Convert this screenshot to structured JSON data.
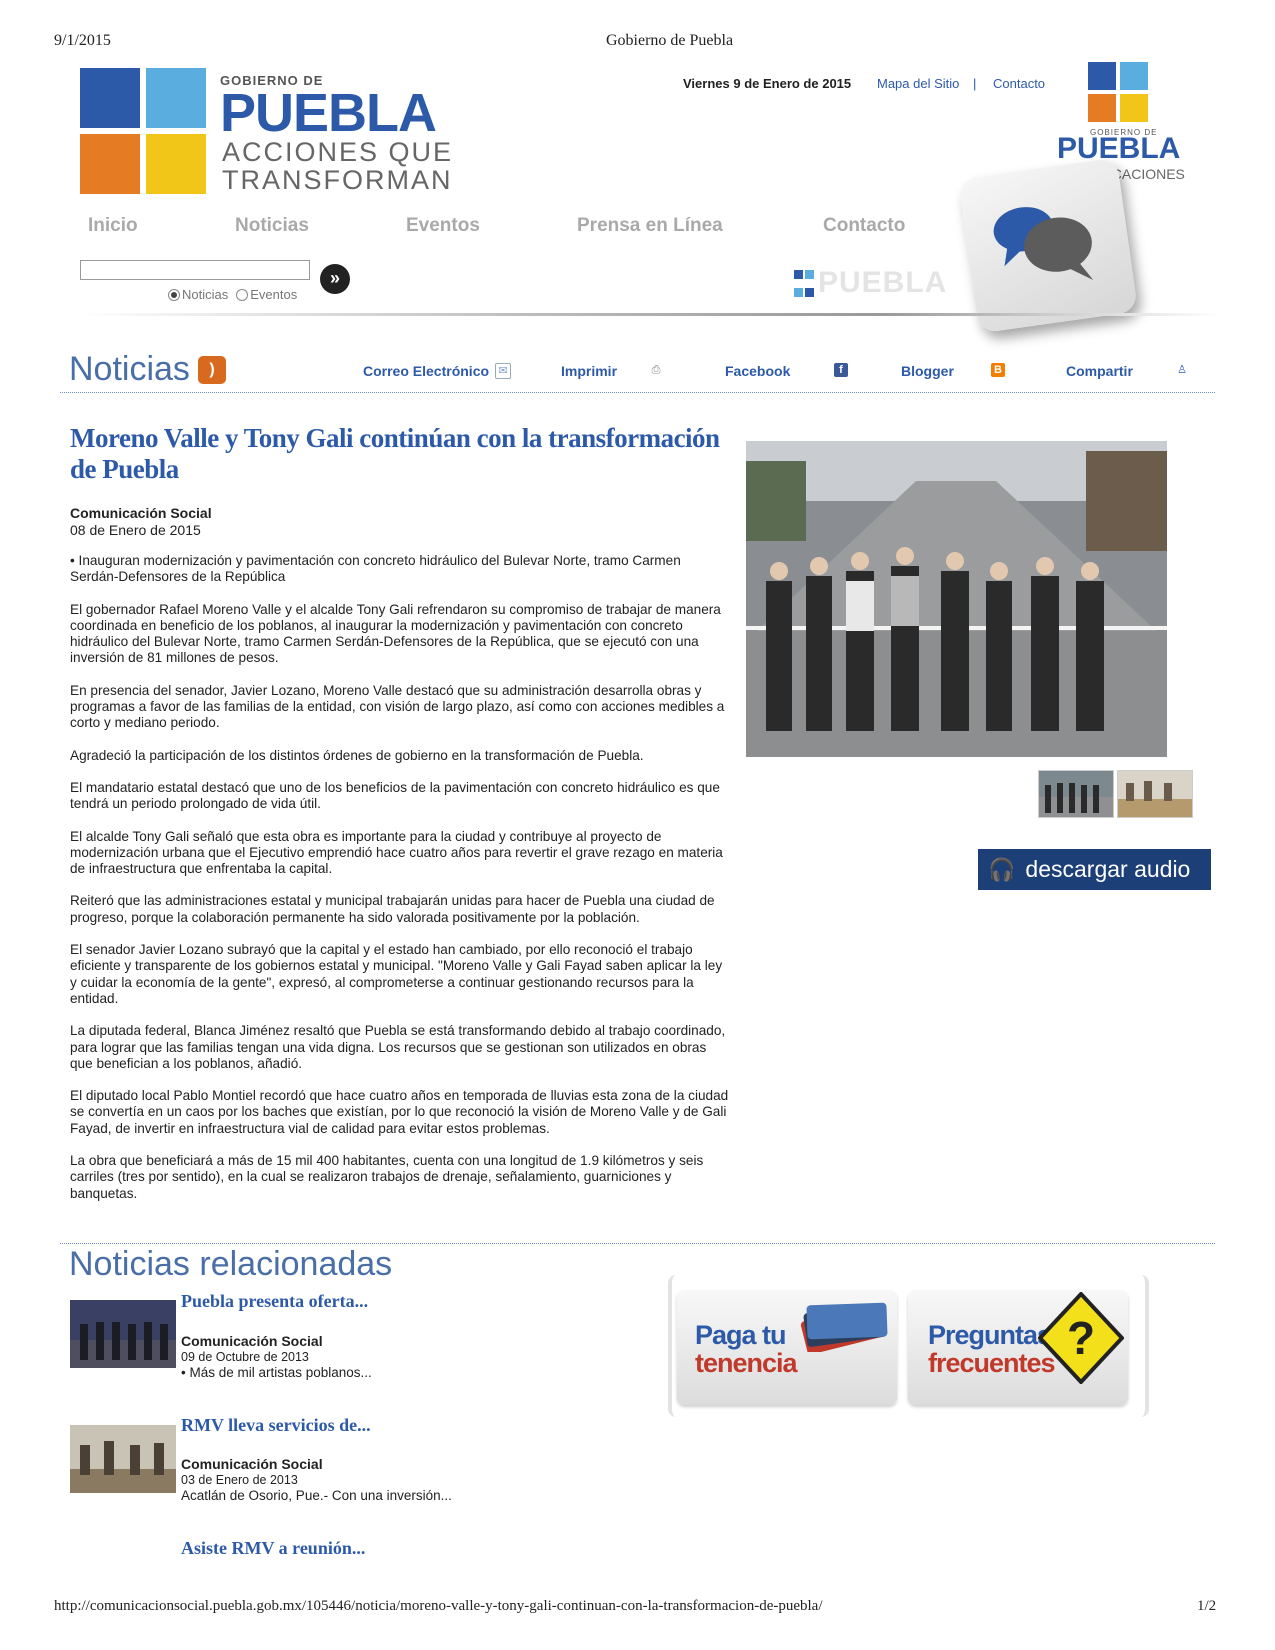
{
  "print": {
    "date": "9/1/2015",
    "title": "Gobierno de Puebla",
    "url": "http://comunicacionsocial.puebla.gob.mx/105446/noticia/moreno-valle-y-tony-gali-continuan-con-la-transformacion-de-puebla/",
    "page": "1/2"
  },
  "logo": {
    "gobierno": "GOBIERNO DE",
    "puebla": "PUEBLA",
    "line1": "ACCIONES QUE",
    "line2": "TRANSFORMAN"
  },
  "top": {
    "date": "Viernes 9 de Enero de 2015",
    "sitemap": "Mapa del Sitio",
    "separator": "|",
    "contact": "Contacto"
  },
  "com_logo": {
    "gobierno": "GOBIERNO DE",
    "puebla": "PUEBLA",
    "sub": "COMUNICACIONES"
  },
  "nav": [
    "Inicio",
    "Noticias",
    "Eventos",
    "Prensa en Línea",
    "Contacto"
  ],
  "search": {
    "value": "",
    "button": "»",
    "options": [
      "Noticias",
      "Eventos"
    ],
    "selected": "Noticias",
    "watermark": "PUEBLA"
  },
  "noticias_bar": {
    "title": "Noticias",
    "share": [
      "Correo Electrónico",
      "Imprimir",
      "Facebook",
      "Blogger",
      "Compartir"
    ]
  },
  "article": {
    "title": "Moreno Valle y Tony Gali continúan con la transformación de Puebla",
    "author": "Comunicación Social",
    "date": "08 de Enero de 2015",
    "paragraphs": [
      "• Inauguran modernización y pavimentación con concreto hidráulico del Bulevar Norte, tramo Carmen Serdán-Defensores de la República",
      "El gobernador Rafael Moreno Valle y el alcalde Tony Gali refrendaron su compromiso de trabajar de manera coordinada en beneficio de los poblanos, al inaugurar la modernización y pavimentación con concreto hidráulico del Bulevar Norte, tramo Carmen Serdán-Defensores de la República, que se ejecutó con una inversión de 81 millones de pesos.",
      "En presencia del senador, Javier Lozano, Moreno Valle destacó que su administración desarrolla obras y programas a favor de las familias de la entidad, con visión de largo plazo, así como con acciones medibles a corto y mediano periodo.",
      "Agradeció la participación de los distintos órdenes de gobierno en la transformación de Puebla.",
      "El mandatario estatal destacó que uno de los beneficios de la pavimentación con concreto hidráulico es que tendrá un periodo prolongado de vida útil.",
      "El alcalde Tony Gali señaló que esta obra es importante para la ciudad y contribuye al proyecto de modernización urbana que el Ejecutivo emprendió hace cuatro años para revertir el grave rezago en materia de infraestructura que enfrentaba la capital.",
      "Reiteró que las administraciones estatal y municipal trabajarán unidas para hacer de Puebla una ciudad de progreso, porque la colaboración permanente ha sido valorada positivamente por la población.",
      "El senador Javier Lozano subrayó que la capital y el estado han cambiado, por ello reconoció el trabajo eficiente y transparente de los gobiernos estatal y municipal. \"Moreno Valle y Gali Fayad saben aplicar la ley y cuidar la economía de la gente\", expresó, al comprometerse a continuar gestionando recursos para la entidad.",
      "La diputada federal, Blanca Jiménez resaltó que Puebla se está transformando debido al trabajo coordinado, para lograr que las familias tengan una vida digna. Los recursos que se gestionan son utilizados en obras que benefician a los poblanos, añadió.",
      "El diputado local Pablo Montiel recordó que hace cuatro años en temporada de lluvias esta zona de la ciudad se convertía en un caos por los baches que existían, por lo que reconoció la visión de Moreno Valle y de Gali Fayad, de invertir en infraestructura vial de calidad para evitar estos problemas.",
      "La obra que beneficiará a más de 15 mil 400 habitantes, cuenta con una longitud de 1.9 kilómetros y seis carriles (tres por sentido), en la cual se realizaron trabajos de drenaje, señalamiento, guarniciones y banquetas."
    ]
  },
  "audio": {
    "label": "descargar audio"
  },
  "related": {
    "title": "Noticias relacionadas",
    "items": [
      {
        "headline": "Puebla presenta oferta...",
        "author": "Comunicación Social",
        "date": "09 de Octubre de 2013",
        "desc": "• Más de mil artistas poblanos..."
      },
      {
        "headline": "RMV lleva servicios de...",
        "author": "Comunicación Social",
        "date": "03 de Enero de 2013",
        "desc": "Acatlán de Osorio, Pue.- Con una inversión..."
      },
      {
        "headline": "Asiste RMV a reunión..."
      }
    ]
  },
  "banners": [
    {
      "line1": "Paga tu",
      "line2": "tenencia"
    },
    {
      "line1": "Preguntas",
      "line2": "frecuentes"
    }
  ],
  "colors": {
    "link_blue": "#2d5aa8",
    "title_blue": "#4a6fa8",
    "audio_bg": "#1d3f78",
    "rss_orange": "#d86a1f"
  }
}
